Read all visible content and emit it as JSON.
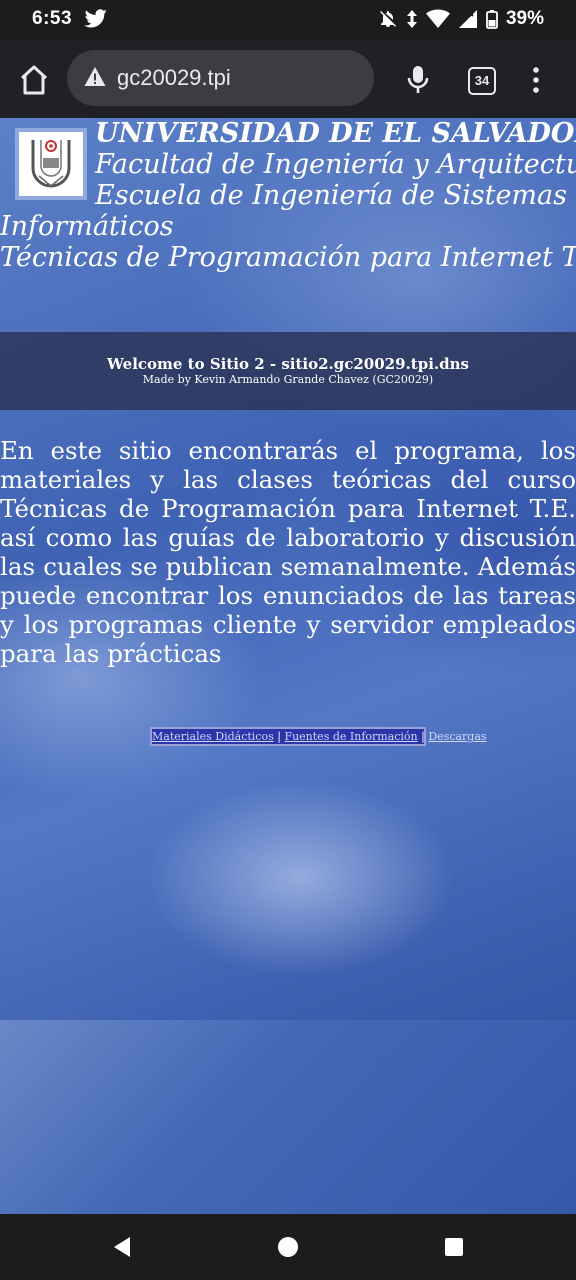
{
  "status_bar": {
    "time": "6:53",
    "battery": "39%",
    "icons": [
      "twitter-icon",
      "bell-off-icon",
      "data-arrows-icon",
      "wifi-icon",
      "signal-icon",
      "battery-icon"
    ]
  },
  "browser": {
    "url": "gc20029.tpi",
    "tab_count": "34",
    "icons": [
      "home-icon",
      "warning-icon",
      "mic-icon",
      "more-vert-icon"
    ]
  },
  "page": {
    "header": {
      "line1": "UNIVERSIDAD DE EL SALVADOR",
      "line2": "Facultad de Ingeniería y Arquitectura",
      "line3a": "Escuela de Ingeniería de Sistemas",
      "line3b": "Informáticos",
      "line4": "Técnicas de Programación para Internet T.E."
    },
    "welcome": {
      "title": "Welcome to Sitio 2 - sitio2.gc20029.tpi.dns",
      "subtitle": "Made by Kevin Armando Grande Chavez (GC20029)"
    },
    "intro": "En este sitio encontrarás el programa, los materiales y las clases teóricas del curso Técnicas de Programación para Internet T.E. así como las guías de laboratorio y discusión las cuales se publican semanalmente. Además puede encontrar los enunciados de las tareas y los programas cliente y servidor empleados para las prácticas",
    "links": {
      "materiales": "Materiales Didácticos",
      "fuentes": "Fuentes de Información",
      "descargas": "Descargas",
      "separator": "|"
    }
  },
  "colors": {
    "page_blue": "#4468b6",
    "link_bar": "#2b35a8"
  }
}
